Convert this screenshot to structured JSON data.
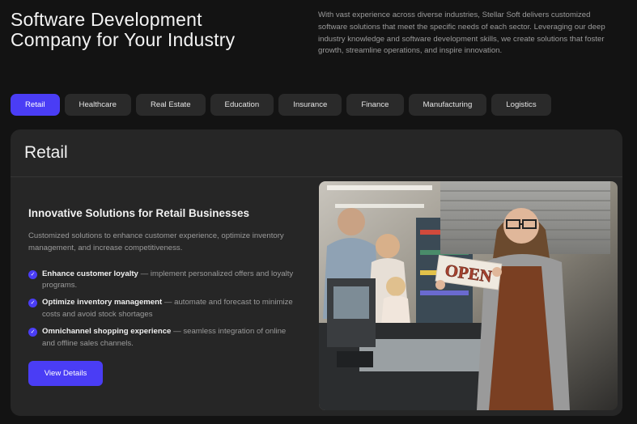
{
  "hero": {
    "title_line1": "Software Development",
    "title_line2": "Company for Your Industry",
    "description": "With vast experience across diverse industries, Stellar Soft delivers customized software solutions that meet the specific needs of each sector. Leveraging our deep industry knowledge and software development skills, we create solutions that foster growth, streamline operations, and inspire innovation."
  },
  "tabs": [
    "Retail",
    "Healthcare",
    "Real Estate",
    "Education",
    "Insurance",
    "Finance",
    "Manufacturing",
    "Logistics"
  ],
  "active_tab": "Retail",
  "panel": {
    "heading": "Retail",
    "title": "Innovative Solutions for Retail Businesses",
    "text": "Customized solutions to enhance customer experience, optimize inventory management, and increase competitiveness.",
    "features": [
      {
        "title": "Enhance customer loyalty",
        "desc": " — implement personalized offers and loyalty programs."
      },
      {
        "title": "Optimize inventory management",
        "desc": " — automate and forecast to minimize costs and avoid stock shortages"
      },
      {
        "title": "Omnichannel shopping experience",
        "desc": " — seamless integration of online and offline sales channels."
      }
    ],
    "cta_label": "View Details",
    "image_sign_text": "OPEN"
  },
  "colors": {
    "accent": "#4a3df5",
    "background": "#131313",
    "panel": "#262626"
  }
}
